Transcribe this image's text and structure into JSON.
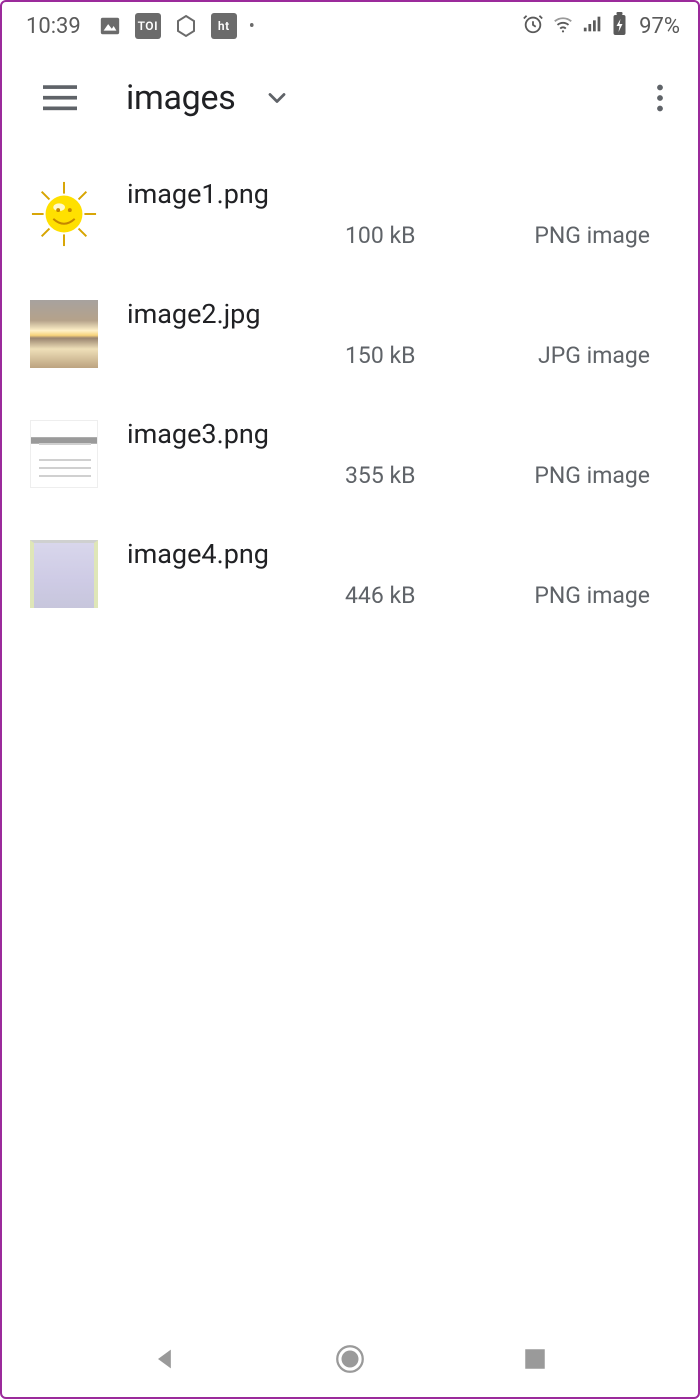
{
  "statusbar": {
    "time": "10:39",
    "battery_pct": "97%",
    "icons_left": [
      "photos",
      "toi",
      "s-logo",
      "ht",
      "dot"
    ],
    "icons_right": [
      "alarm",
      "wifi",
      "signal",
      "battery"
    ]
  },
  "header": {
    "title": "images"
  },
  "files": [
    {
      "name": "image1.png",
      "size": "100 kB",
      "type": "PNG image",
      "thumb": "sun"
    },
    {
      "name": "image2.jpg",
      "size": "150 kB",
      "type": "JPG image",
      "thumb": "sunset"
    },
    {
      "name": "image3.png",
      "size": "355 kB",
      "type": "PNG image",
      "thumb": "doc"
    },
    {
      "name": "image4.png",
      "size": "446 kB",
      "type": "PNG image",
      "thumb": "purple"
    }
  ]
}
